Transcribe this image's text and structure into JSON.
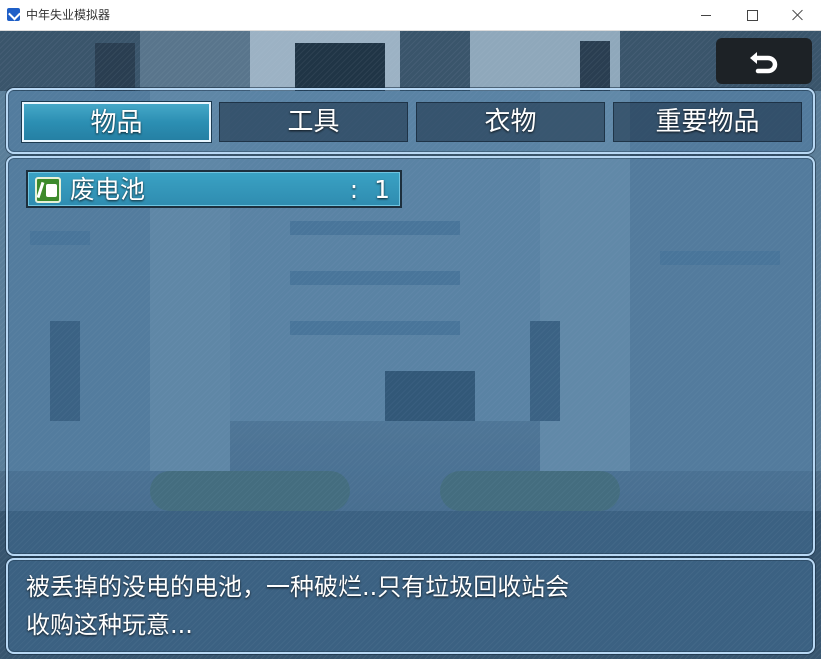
{
  "window": {
    "title": "中年失业模拟器"
  },
  "menu": {
    "back_icon": "return-arrow-icon",
    "tabs": [
      {
        "label": "物品",
        "active": true
      },
      {
        "label": "工具",
        "active": false
      },
      {
        "label": "衣物",
        "active": false
      },
      {
        "label": "重要物品",
        "active": false
      }
    ]
  },
  "items": [
    {
      "name": "废电池",
      "quantity": ":  1",
      "icon": "battery-icon"
    }
  ],
  "help": {
    "line1": "被丢掉的没电的电池，一种破烂..只有垃圾回收站会",
    "line2": "收购这种玩意..."
  },
  "colors": {
    "active_tab": "#2c8fb3",
    "window_border": "#b8d8f4",
    "item_icon_bg": "#3d8a2c"
  }
}
